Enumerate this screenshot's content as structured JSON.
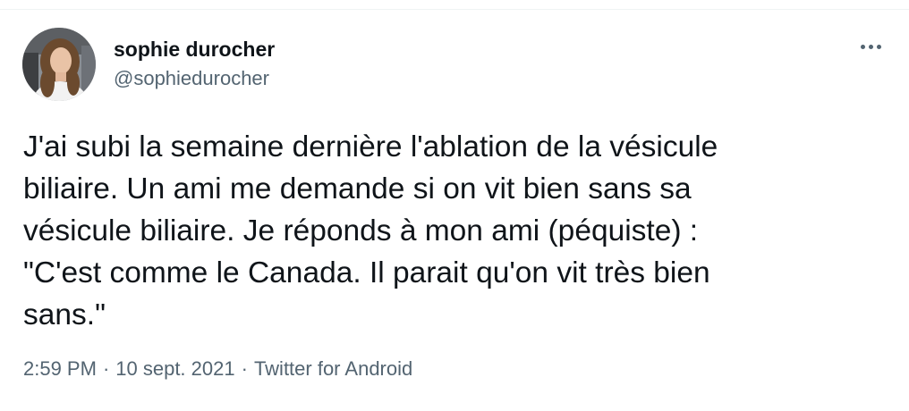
{
  "tweet": {
    "display_name": "sophie durocher",
    "handle": "@sophiedurocher",
    "text": "J'ai subi la semaine dernière l'ablation de la vésicule\nbiliaire. Un ami me demande si on vit bien sans sa\nvésicule biliaire.  Je réponds à mon ami (péquiste) :\n\"C'est comme le Canada. Il parait qu'on vit très bien\nsans.\"",
    "time": "2:59 PM",
    "separator": "·",
    "date": "10 sept. 2021",
    "source": "Twitter for Android"
  },
  "colors": {
    "text_primary": "#0f1419",
    "text_secondary": "#536471",
    "divider": "#eff3f4"
  },
  "icons": {
    "more": "more-horizontal-icon"
  }
}
